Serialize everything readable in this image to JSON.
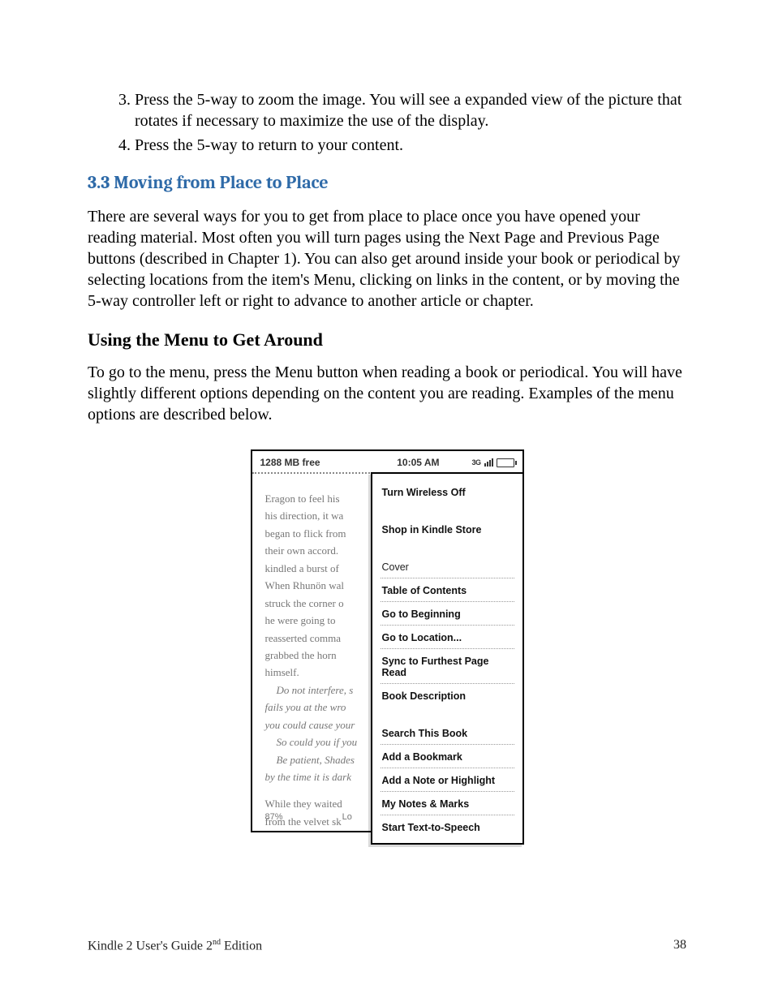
{
  "instructions": {
    "item3": "Press the 5-way to zoom the image. You will see a expanded view of the picture that rotates if necessary to maximize the use of the display.",
    "item4": "Press the 5-way to return to your content."
  },
  "section": {
    "title": "3.3 Moving from Place to Place",
    "intro": "There are several ways for you to get from place to place once you have opened your reading material. Most often you will turn pages using the Next Page and Previous Page buttons (described in Chapter 1). You can also get around inside your book or periodical by selecting locations from the item's Menu, clicking on links in the content, or by moving the 5-way controller left or right to advance to another article or chapter."
  },
  "subsection": {
    "heading": "Using the Menu to Get Around",
    "paragraph": "To go to the menu, press the Menu button when reading a book or periodical. You will have slightly different options depending on the content you are reading. Examples of the menu options are described below."
  },
  "device": {
    "status": {
      "memory": "1288 MB free",
      "time": "10:05 AM",
      "network": "3G"
    },
    "book": {
      "line1": "Eragon to feel his",
      "line2": "his direction, it wa",
      "line3": "began to flick from",
      "line4": "their own accord.",
      "line5": "kindled a burst of",
      "line6": "When Rhunön wal",
      "line7": "struck the corner o",
      "line8": "he were going to",
      "line9": "reasserted comma",
      "line10": "grabbed the horn",
      "line11": "himself.",
      "line12": "Do not interfere, s",
      "line13": "fails you at the wro",
      "line14": "you could cause your",
      "line15": "So could you if you",
      "line16": "Be patient, Shades",
      "line17": "by the time it is dark",
      "line18": "While they waited",
      "line19": "from the velvet sk",
      "progress": "87%",
      "loc_label": "Lo"
    },
    "menu": {
      "m1": "Turn Wireless Off",
      "m2": "Shop in Kindle Store",
      "m3": "Cover",
      "m4": "Table of Contents",
      "m5": "Go to Beginning",
      "m6": "Go to Location...",
      "m7": "Sync to Furthest Page Read",
      "m8": "Book Description",
      "m9": "Search This Book",
      "m10": "Add a Bookmark",
      "m11": "Add a Note or Highlight",
      "m12": "My Notes & Marks",
      "m13": "Start Text-to-Speech"
    }
  },
  "footer": {
    "guide_prefix": "Kindle 2 User's Guide 2",
    "guide_suffix": " Edition",
    "ordinal": "nd",
    "page_number": "38"
  }
}
